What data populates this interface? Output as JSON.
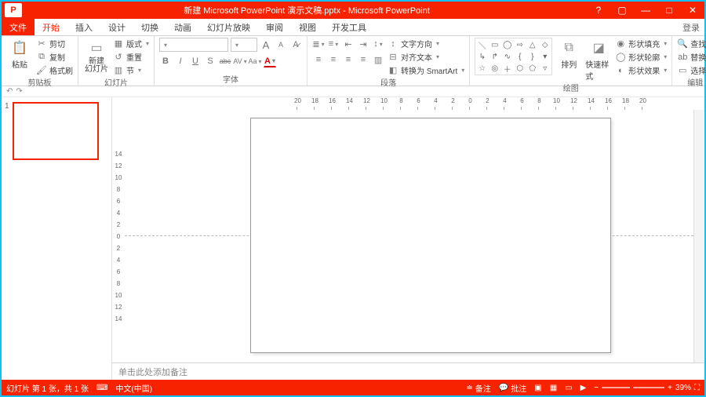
{
  "title": "新建 Microsoft PowerPoint 演示文稿.pptx  -  Microsoft PowerPoint",
  "winbuttons": {
    "help": "?",
    "rib": "▢",
    "min": "—",
    "max": "□",
    "close": "✕"
  },
  "login": "登录",
  "tabs": {
    "file": "文件",
    "home": "开始",
    "insert": "插入",
    "design": "设计",
    "transition": "切换",
    "animation": "动画",
    "slideshow": "幻灯片放映",
    "review": "审阅",
    "view": "视图",
    "dev": "开发工具"
  },
  "ribbon": {
    "clipboard": {
      "paste": "粘贴",
      "cut": "剪切",
      "copy": "复制",
      "painter": "格式刷",
      "label": "剪贴板"
    },
    "slides": {
      "new": "新建\n幻灯片",
      "layout": "版式",
      "reset": "重置",
      "section": "节",
      "label": "幻灯片"
    },
    "font": {
      "label": "字体",
      "a_inc": "A",
      "a_dec": "A",
      "b": "B",
      "i": "I",
      "u": "U",
      "s": "S",
      "abc": "abc",
      "av": "AV",
      "aa": "Aa"
    },
    "para": {
      "label": "段落",
      "dir": "文字方向",
      "align": "对齐文本",
      "smart": "转换为 SmartArt"
    },
    "draw": {
      "label": "绘图",
      "arrange": "排列",
      "quick": "快速样式",
      "fill": "形状填充",
      "outline": "形状轮廓",
      "fx": "形状效果"
    },
    "edit": {
      "label": "编辑",
      "find": "查找",
      "replace": "替换",
      "select": "选择"
    }
  },
  "ruler_h": [
    "20",
    "18",
    "16",
    "14",
    "12",
    "10",
    "8",
    "6",
    "4",
    "2",
    "0",
    "2",
    "4",
    "6",
    "8",
    "10",
    "12",
    "14",
    "16",
    "18",
    "20"
  ],
  "ruler_v": [
    "14",
    "12",
    "10",
    "8",
    "6",
    "4",
    "2",
    "0",
    "2",
    "4",
    "6",
    "8",
    "10",
    "12",
    "14"
  ],
  "thumb_num": "1",
  "notes_placeholder": "单击此处添加备注",
  "status": {
    "slide": "幻灯片 第 1 张，共 1 张",
    "lang": "中文(中国)",
    "notes": "备注",
    "comments": "批注",
    "zoom": "39%"
  }
}
